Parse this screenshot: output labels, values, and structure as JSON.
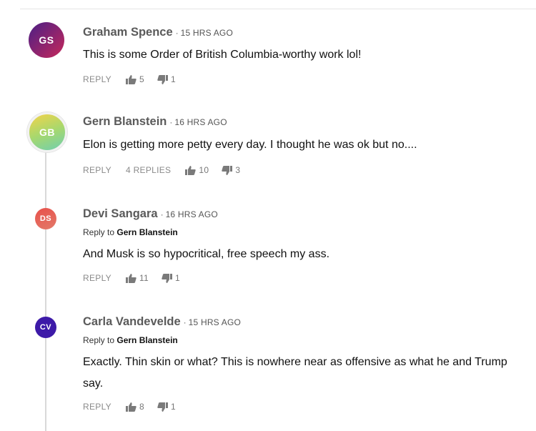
{
  "comments": [
    {
      "initials": "GS",
      "name": "Graham Spence",
      "time": "15 HRS AGO",
      "reply_to_prefix": "",
      "reply_to": "",
      "body": "This is some Order of British Columbia-worthy work lol!",
      "actions": {
        "reply": "REPLY",
        "replies": "",
        "likes": "5",
        "dislikes": "1"
      }
    },
    {
      "initials": "GB",
      "name": "Gern Blanstein",
      "time": "16 HRS AGO",
      "reply_to_prefix": "",
      "reply_to": "",
      "body": "Elon is getting more petty every day. I thought he was ok but no....",
      "actions": {
        "reply": "REPLY",
        "replies": "4 REPLIES",
        "likes": "10",
        "dislikes": "3"
      }
    },
    {
      "initials": "DS",
      "name": "Devi Sangara",
      "time": "16 HRS AGO",
      "reply_to_prefix": "Reply to",
      "reply_to": "Gern Blanstein",
      "body": "And Musk is so hypocritical, free speech my ass.",
      "actions": {
        "reply": "REPLY",
        "replies": "",
        "likes": "11",
        "dislikes": "1"
      }
    },
    {
      "initials": "CV",
      "name": "Carla Vandevelde",
      "time": "15 HRS AGO",
      "reply_to_prefix": "Reply to",
      "reply_to": "Gern Blanstein",
      "body": "Exactly. Thin skin or what? This is nowhere near as offensive as what he and Trump say.",
      "actions": {
        "reply": "REPLY",
        "replies": "",
        "likes": "8",
        "dislikes": "1"
      }
    }
  ],
  "icons": {
    "like": "thumbs-up-icon",
    "dislike": "thumbs-down-icon"
  },
  "colors": {
    "avatar_gs": [
      "#5a1f7a",
      "#c22a55"
    ],
    "avatar_gb": [
      "#f2d14b",
      "#7fd1a6"
    ],
    "avatar_ds": "#e25a4e",
    "avatar_cv": "#3d1aa8"
  }
}
